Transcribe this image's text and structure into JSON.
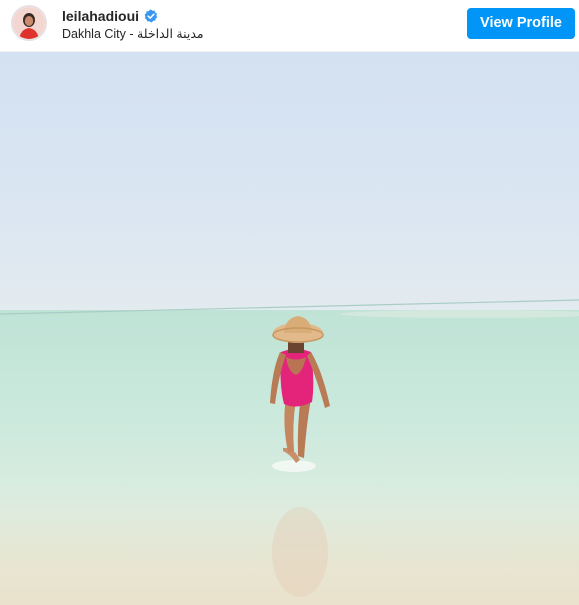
{
  "post": {
    "username": "leilahadioui",
    "location": "Dakhla City - مدينة الداخلة",
    "view_profile_label": "View Profile"
  },
  "icons": {
    "verified": "verified-badge-icon",
    "avatar": "profile-avatar"
  },
  "colors": {
    "button_bg": "#0095f6",
    "verified_blue": "#3897f0",
    "text": "#262626"
  }
}
